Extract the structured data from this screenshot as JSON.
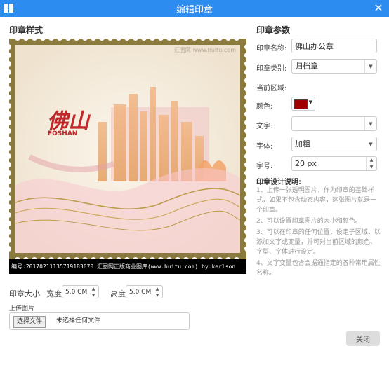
{
  "window": {
    "title": "编辑印章",
    "close_glyph": "×"
  },
  "left": {
    "title": "印章样式",
    "stamp": {
      "watermark": "汇图网 www.huitu.com",
      "city_text": "佛山",
      "city_en": "FOSHAN",
      "caption": "编号:20170211135719183070  汇图网正版商业图库(www.huitu.com) by:kerlson"
    },
    "size_label": "印章大小",
    "width_label": "宽度",
    "width_value": "5.0 CM",
    "height_label": "高度",
    "height_value": "5.0 CM",
    "upload_label": "上传图片",
    "file_button": "选择文件",
    "file_status": "未选择任何文件"
  },
  "right": {
    "title": "印章参数",
    "name_label": "印章名称:",
    "name_value": "佛山办公章",
    "type_label": "印章类别:",
    "type_value": "归档章",
    "region_label": "当前区域:",
    "color_label": "颜色:",
    "color_value": "#a00000",
    "text_label": "文字:",
    "text_value": "",
    "font_label": "字体:",
    "font_value": "加粗",
    "size_label": "字号:",
    "size_value": "20 px",
    "notes_title": "印章设计说明:",
    "notes": [
      "1、上传一张透明图片，作为印章的基础样式，如果不包含动态内容，这张图片就是一个印章。",
      "2、可以设置印章图片的大小和颜色。",
      "3、可以在印章的任何位置，设定子区域，以添加文字或变量，并可对当前区域的颜色、字型、字体进行设定。",
      "4、文字变量包含会据通指定的各种常用属性名称。"
    ]
  },
  "footer": {
    "close_label": "关闭"
  },
  "icons": {
    "window": "windows-grid-icon",
    "dropdown": "caret-down-icon",
    "spinner": "spinner-arrows-icon"
  },
  "colors": {
    "titlebar": "#2d8cf0",
    "stamp_frame": "#8a7a3e",
    "stamp_red": "#c0282b"
  }
}
